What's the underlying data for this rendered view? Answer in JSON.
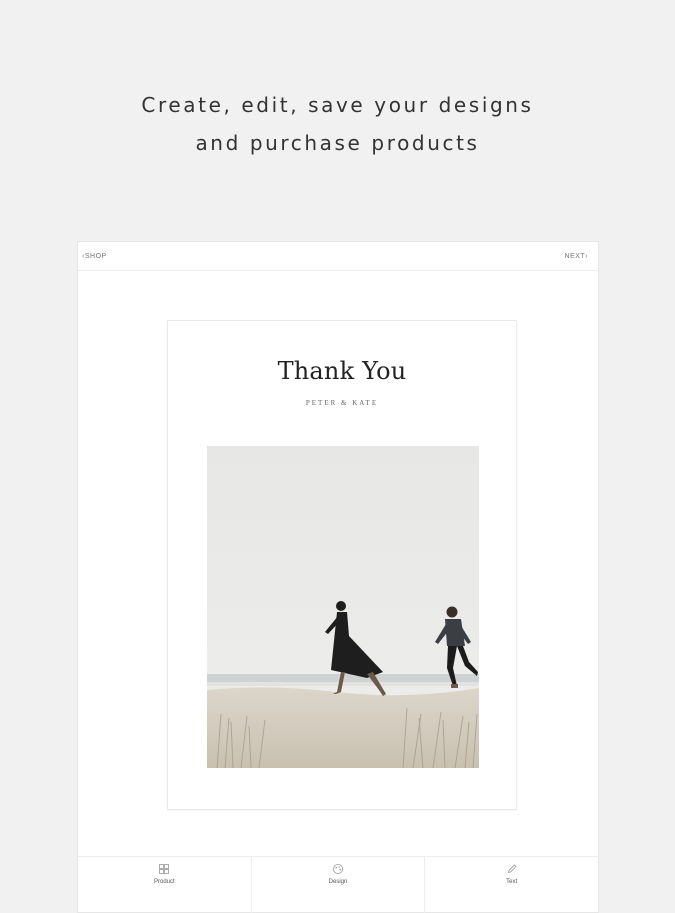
{
  "headline": {
    "line1": "Create, edit, save your designs",
    "line2": "and purchase products"
  },
  "topbar": {
    "back_label": "SHOP",
    "next_label": "NEXT"
  },
  "card": {
    "title": "Thank You",
    "subtitle": "PETER & KATE"
  },
  "tabs": [
    {
      "label": "Product",
      "icon": "grid-icon"
    },
    {
      "label": "Design",
      "icon": "palette-icon"
    },
    {
      "label": "Text",
      "icon": "pen-icon"
    }
  ]
}
